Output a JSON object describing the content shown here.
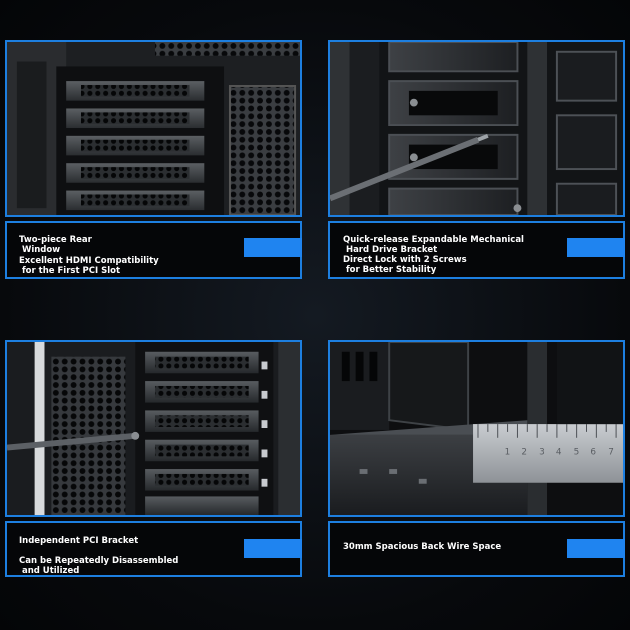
{
  "colors": {
    "accent": "#1f84f0",
    "border": "#1d7fe0",
    "background": "#07090c"
  },
  "tiles": [
    {
      "photo": "rear-pci-slots-photo",
      "captions": [
        "Two-piece Rear\n Window",
        "Excellent HDMI Compatibility\n for the First PCI Slot"
      ]
    },
    {
      "photo": "hard-drive-bracket-photo",
      "captions": [
        "Quick-release Expandable Mechanical\n Hard Drive Bracket",
        "Direct Lock with 2 Screws\n for Better Stability"
      ]
    },
    {
      "photo": "pci-bracket-photo",
      "captions": [
        "Independent PCI Bracket",
        "Can be Repeatedly Disassembled\n and Utilized"
      ]
    },
    {
      "photo": "back-wire-space-photo",
      "captions": [
        "30mm Spacious Back Wire Space"
      ],
      "ruler_numbers": [
        "1",
        "2",
        "3",
        "4",
        "5",
        "6",
        "7"
      ]
    }
  ]
}
